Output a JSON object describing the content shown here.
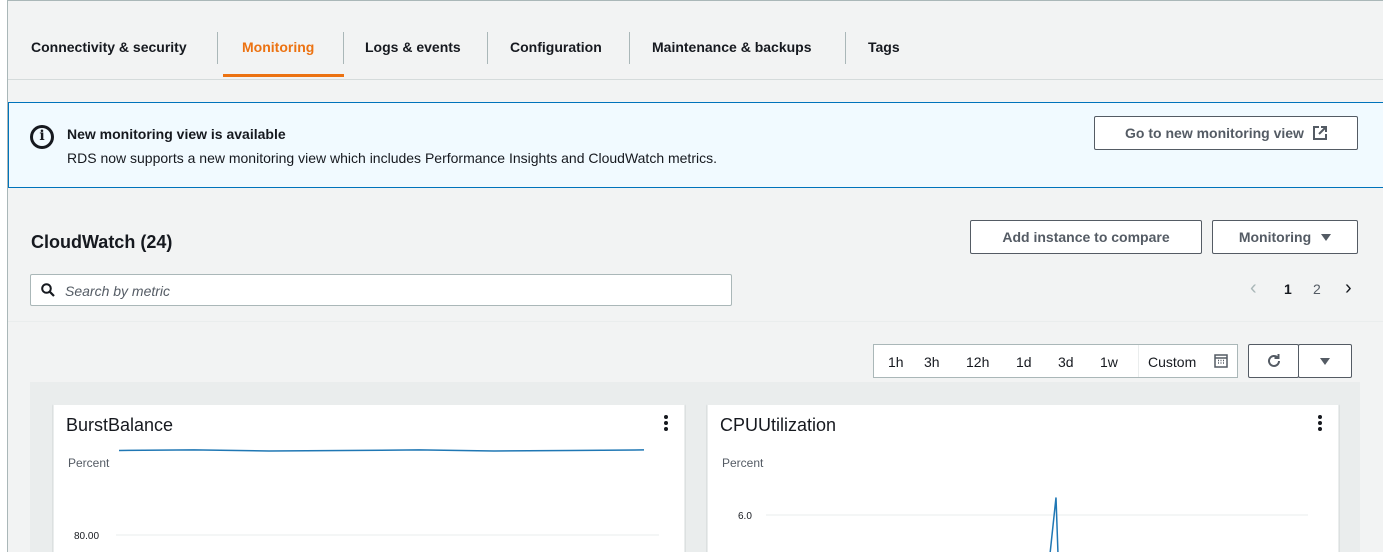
{
  "tabs": [
    {
      "label": "Connectivity & security",
      "active": false
    },
    {
      "label": "Monitoring",
      "active": true
    },
    {
      "label": "Logs & events",
      "active": false
    },
    {
      "label": "Configuration",
      "active": false
    },
    {
      "label": "Maintenance & backups",
      "active": false
    },
    {
      "label": "Tags",
      "active": false
    }
  ],
  "banner": {
    "title": "New monitoring view is available",
    "text": "RDS now supports a new monitoring view which includes Performance Insights and CloudWatch metrics.",
    "button_label": "Go to new monitoring view",
    "icon": "info-icon",
    "external_icon": "external-link-icon"
  },
  "cloudwatch": {
    "title": "CloudWatch (24)",
    "add_button_label": "Add instance to compare",
    "monitoring_button_label": "Monitoring",
    "search_placeholder": "Search by metric"
  },
  "pagination": {
    "prev": "‹",
    "pages": [
      "1",
      "2"
    ],
    "current": "1",
    "next": "›"
  },
  "time_range": {
    "options": [
      "1h",
      "3h",
      "12h",
      "1d",
      "3d",
      "1w"
    ],
    "custom_label": "Custom",
    "refresh_icon": "refresh-icon",
    "more_icon": "caret-down-icon"
  },
  "colors": {
    "accent": "#ec7211",
    "info_border": "#0073bb",
    "info_bg": "#f1faff",
    "line": "#1f77b4"
  },
  "charts": [
    {
      "title": "BurstBalance",
      "unit": "Percent",
      "tick": "80.00"
    },
    {
      "title": "CPUUtilization",
      "unit": "Percent",
      "tick": "6.0"
    }
  ],
  "chart_data": [
    {
      "type": "line",
      "title": "BurstBalance",
      "ylabel": "Percent",
      "yticks": [
        80.0
      ],
      "series": [
        {
          "values": [
            99,
            99,
            99,
            99,
            99,
            99,
            99,
            99
          ]
        }
      ]
    },
    {
      "type": "line",
      "title": "CPUUtilization",
      "ylabel": "Percent",
      "yticks": [
        6.0
      ],
      "series": [
        {
          "values": [
            null,
            null,
            6.7,
            0
          ]
        }
      ]
    }
  ]
}
